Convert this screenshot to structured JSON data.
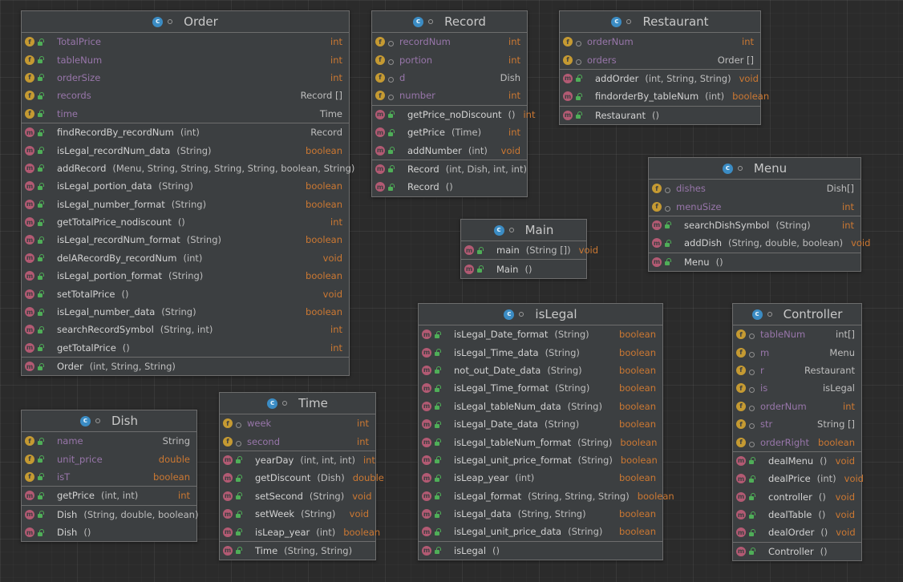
{
  "classes": {
    "Order": {
      "title": "Order",
      "fields": [
        [
          "TotalPrice",
          "int"
        ],
        [
          "tableNum",
          "int"
        ],
        [
          "orderSize",
          "int"
        ],
        [
          "records",
          "Record []"
        ],
        [
          "time",
          "Time"
        ]
      ],
      "methods": [
        [
          "findRecordBy_recordNum",
          "(int)",
          "Record"
        ],
        [
          "isLegal_recordNum_data",
          "(String)",
          "boolean"
        ],
        [
          "addRecord",
          "(Menu, String, String, String, String, boolean, String)",
          ""
        ],
        [
          "isLegal_portion_data",
          "(String)",
          "boolean"
        ],
        [
          "isLegal_number_format",
          "(String)",
          "boolean"
        ],
        [
          "getTotalPrice_nodiscount",
          "()",
          "int"
        ],
        [
          "isLegal_recordNum_format",
          "(String)",
          "boolean"
        ],
        [
          "delARecordBy_recordNum",
          "(int)",
          "void"
        ],
        [
          "isLegal_portion_format",
          "(String)",
          "boolean"
        ],
        [
          "setTotalPrice",
          "()",
          "void"
        ],
        [
          "isLegal_number_data",
          "(String)",
          "boolean"
        ],
        [
          "searchRecordSymbol",
          "(String, int)",
          "int"
        ],
        [
          "getTotalPrice",
          "()",
          "int"
        ]
      ],
      "ctors": [
        [
          "Order",
          "(int, String, String)"
        ]
      ]
    },
    "Record": {
      "title": "Record",
      "fields": [
        [
          "recordNum",
          "int"
        ],
        [
          "portion",
          "int"
        ],
        [
          "d",
          "Dish"
        ],
        [
          "number",
          "int"
        ]
      ],
      "methods": [
        [
          "getPrice_noDiscount",
          "()",
          "int"
        ],
        [
          "getPrice",
          "(Time)",
          "int"
        ],
        [
          "addNumber",
          "(int)",
          "void"
        ]
      ],
      "ctors": [
        [
          "Record",
          "(int, Dish, int, int)"
        ],
        [
          "Record",
          "()"
        ]
      ]
    },
    "Restaurant": {
      "title": "Restaurant",
      "fields": [
        [
          "orderNum",
          "int"
        ],
        [
          "orders",
          "Order []"
        ]
      ],
      "methods": [
        [
          "addOrder",
          "(int, String, String)",
          "void"
        ],
        [
          "findorderBy_tableNum",
          "(int)",
          "boolean"
        ]
      ],
      "ctors": [
        [
          "Restaurant",
          "()"
        ]
      ]
    },
    "Menu": {
      "title": "Menu",
      "fields": [
        [
          "dishes",
          "Dish[]"
        ],
        [
          "menuSize",
          "int"
        ]
      ],
      "methods": [
        [
          "searchDishSymbol",
          "(String)",
          "int"
        ],
        [
          "addDish",
          "(String, double, boolean)",
          "void"
        ]
      ],
      "ctors": [
        [
          "Menu",
          "()"
        ]
      ]
    },
    "Main": {
      "title": "Main",
      "fields": [],
      "methods": [
        [
          "main",
          "(String [])",
          "void"
        ]
      ],
      "ctors": [
        [
          "Main",
          "()"
        ]
      ]
    },
    "isLegal": {
      "title": "isLegal",
      "fields": [],
      "methods": [
        [
          "isLegal_Date_format",
          "(String)",
          "boolean"
        ],
        [
          "isLegal_Time_data",
          "(String)",
          "boolean"
        ],
        [
          "not_out_Date_data",
          "(String)",
          "boolean"
        ],
        [
          "isLegal_Time_format",
          "(String)",
          "boolean"
        ],
        [
          "isLegal_tableNum_data",
          "(String)",
          "boolean"
        ],
        [
          "isLegal_Date_data",
          "(String)",
          "boolean"
        ],
        [
          "isLegal_tableNum_format",
          "(String)",
          "boolean"
        ],
        [
          "isLegal_unit_price_format",
          "(String)",
          "boolean"
        ],
        [
          "isLeap_year",
          "(int)",
          "boolean"
        ],
        [
          "isLegal_format",
          "(String, String, String)",
          "boolean"
        ],
        [
          "isLegal_data",
          "(String, String)",
          "boolean"
        ],
        [
          "isLegal_unit_price_data",
          "(String)",
          "boolean"
        ]
      ],
      "ctors": [
        [
          "isLegal",
          "()"
        ]
      ]
    },
    "Controller": {
      "title": "Controller",
      "fields": [
        [
          "tableNum",
          "int[]"
        ],
        [
          "m",
          "Menu"
        ],
        [
          "r",
          "Restaurant"
        ],
        [
          "is",
          "isLegal"
        ],
        [
          "orderNum",
          "int"
        ],
        [
          "str",
          "String []"
        ],
        [
          "orderRight",
          "boolean"
        ]
      ],
      "methods": [
        [
          "dealMenu",
          "()",
          "void"
        ],
        [
          "dealPrice",
          "(int)",
          "void"
        ],
        [
          "controller",
          "()",
          "void"
        ],
        [
          "dealTable",
          "()",
          "void"
        ],
        [
          "dealOrder",
          "()",
          "void"
        ]
      ],
      "ctors": [
        [
          "Controller",
          "()"
        ]
      ]
    },
    "Dish": {
      "title": "Dish",
      "fields": [
        [
          "name",
          "String"
        ],
        [
          "unit_price",
          "double"
        ],
        [
          "isT",
          "boolean"
        ]
      ],
      "methods": [
        [
          "getPrice",
          "(int, int)",
          "int"
        ]
      ],
      "ctors": [
        [
          "Dish",
          "(String, double, boolean)"
        ],
        [
          "Dish",
          "()"
        ]
      ]
    },
    "Time": {
      "title": "Time",
      "fields": [
        [
          "week",
          "int"
        ],
        [
          "second",
          "int"
        ]
      ],
      "methods": [
        [
          "yearDay",
          "(int, int, int)",
          "int"
        ],
        [
          "getDiscount",
          "(Dish)",
          "double"
        ],
        [
          "setSecond",
          "(String)",
          "void"
        ],
        [
          "setWeek",
          "(String)",
          "void"
        ],
        [
          "isLeap_year",
          "(int)",
          "boolean"
        ]
      ],
      "ctors": [
        [
          "Time",
          "(String, String)"
        ]
      ]
    }
  },
  "colors": {
    "background": "#2b2b2b",
    "box": "#3c3f41",
    "field_icon": "#c59a32",
    "method_icon": "#b35a73",
    "class_icon": "#3b8cc4",
    "keyword": "#cc7832",
    "field_name": "#9876aa",
    "public_lock": "#4fae58"
  },
  "icons": {
    "class": "c-class-icon",
    "field": "f-field-icon",
    "method": "m-method-icon",
    "public": "unlocked-icon",
    "private": "private-dot-icon"
  }
}
